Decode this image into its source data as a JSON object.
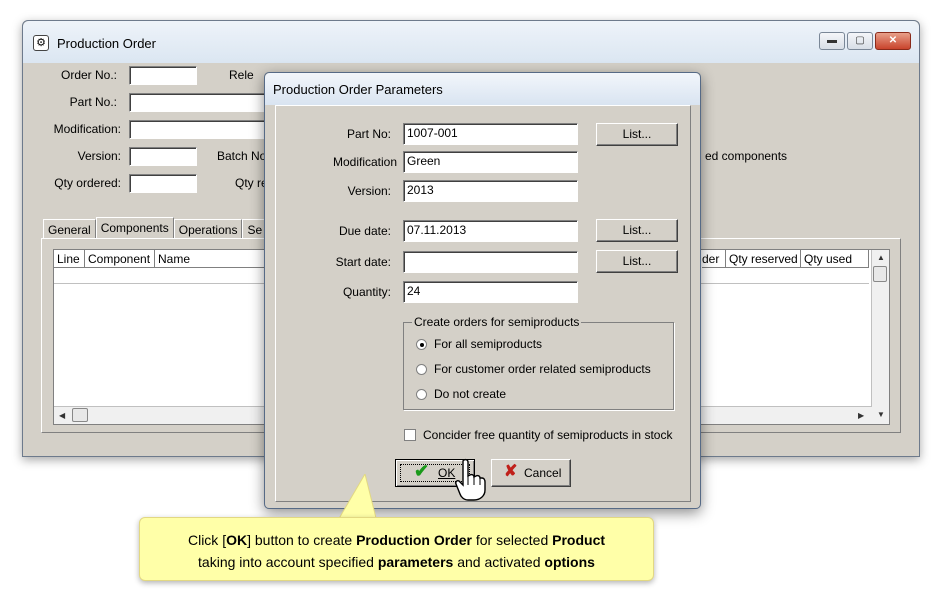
{
  "main": {
    "title": "Production Order",
    "fields": {
      "order_no": "Order No.:",
      "part_no": "Part No.:",
      "modification": "Modification:",
      "version": "Version:",
      "qty_ordered": "Qty ordered:",
      "release_partial": "Rele",
      "batch_no_partial": "Batch No",
      "qty_re_partial": "Qty re",
      "related_components_partial": "ed components"
    },
    "tabs": [
      "General",
      "Components",
      "Operations",
      "Se"
    ],
    "grid_columns": [
      "Line",
      "Component",
      "Name",
      "der",
      "Qty reserved",
      "Qty used"
    ]
  },
  "dialog": {
    "title": "Production Order Parameters",
    "part_no_label": "Part No:",
    "part_no_value": "1007-001",
    "modification_label": "Modification",
    "modification_value": "Green",
    "version_label": "Version:",
    "version_value": "2013",
    "due_date_label": "Due date:",
    "due_date_value": "07.11.2013",
    "start_date_label": "Start date:",
    "start_date_value": "",
    "quantity_label": "Quantity:",
    "quantity_value": "24",
    "list_label": "List...",
    "group_title": "Create orders for semiproducts",
    "options": [
      "For all semiproducts",
      "For customer order related semiproducts",
      "Do not create"
    ],
    "selected_option": "For all semiproducts",
    "checkbox_label": "Concider free quantity of semiproducts in stock",
    "checkbox_checked": false,
    "ok_label": "OK",
    "cancel_label": "Cancel"
  },
  "callout": {
    "t1": "Click [",
    "t2": "OK",
    "t3": "] button to create ",
    "t4": "Production Order",
    "t5": " for selected ",
    "t6": "Product",
    "t7": "taking into account specified ",
    "t8": "parameters",
    "t9": " and activated ",
    "t10": "options"
  },
  "colors": {
    "window_bg": "#d4d0c8",
    "callout_bg": "#ffffa8",
    "ok_check": "#1a9a1a",
    "cancel_x": "#c0201a"
  }
}
